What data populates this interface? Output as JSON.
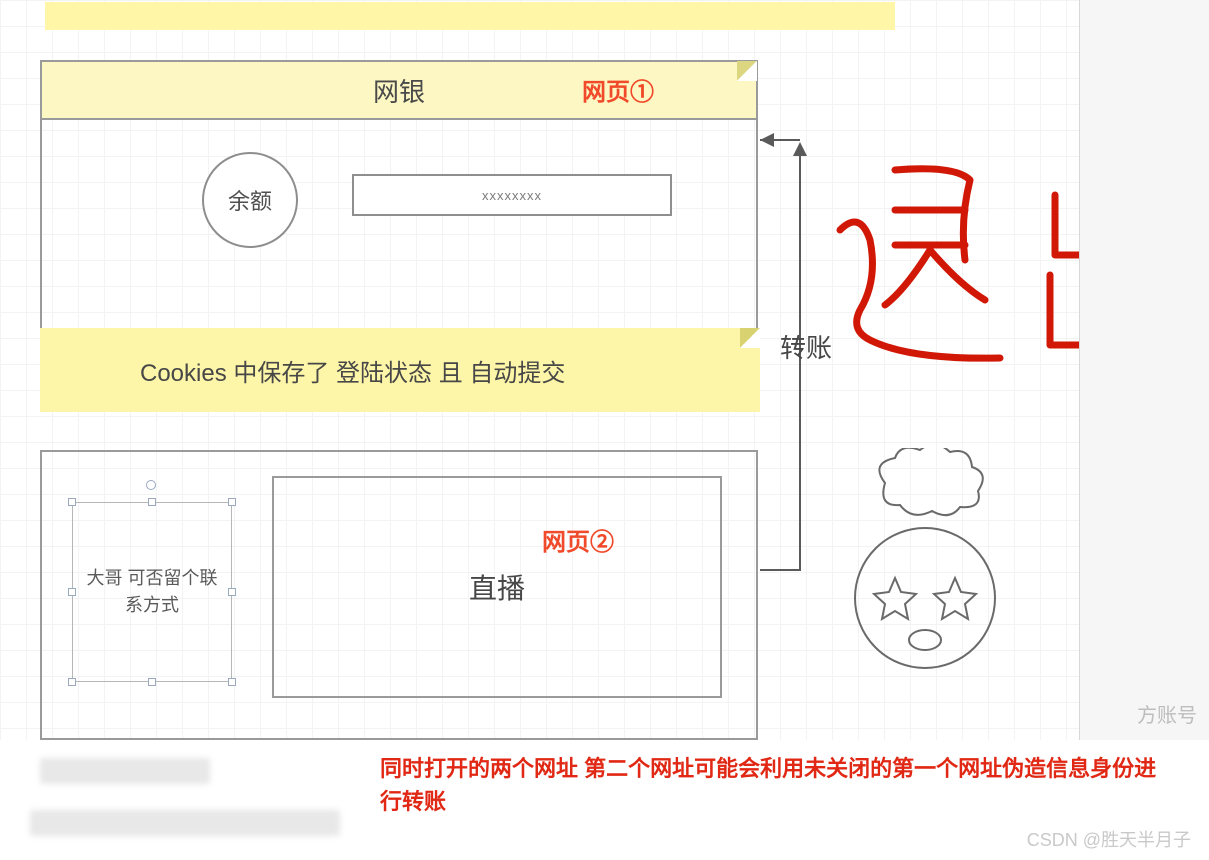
{
  "page1": {
    "title": "网银",
    "label": "网页①",
    "balance_label": "余额",
    "input_value": "xxxxxxxx"
  },
  "cookies_banner": "Cookies 中保存了 登陆状态 且 自动提交",
  "page2": {
    "label": "网页②",
    "message_box": "大哥 可否留个联系方式",
    "main_title": "直播"
  },
  "arrow_label": "转账",
  "handwriting": "退出",
  "footer_text": "同时打开的两个网址 第二个网址可能会利用未关闭的第一个网址伪造信息身份进行转账",
  "watermark": "CSDN @胜天半月子",
  "right_panel_faded": "方账号"
}
